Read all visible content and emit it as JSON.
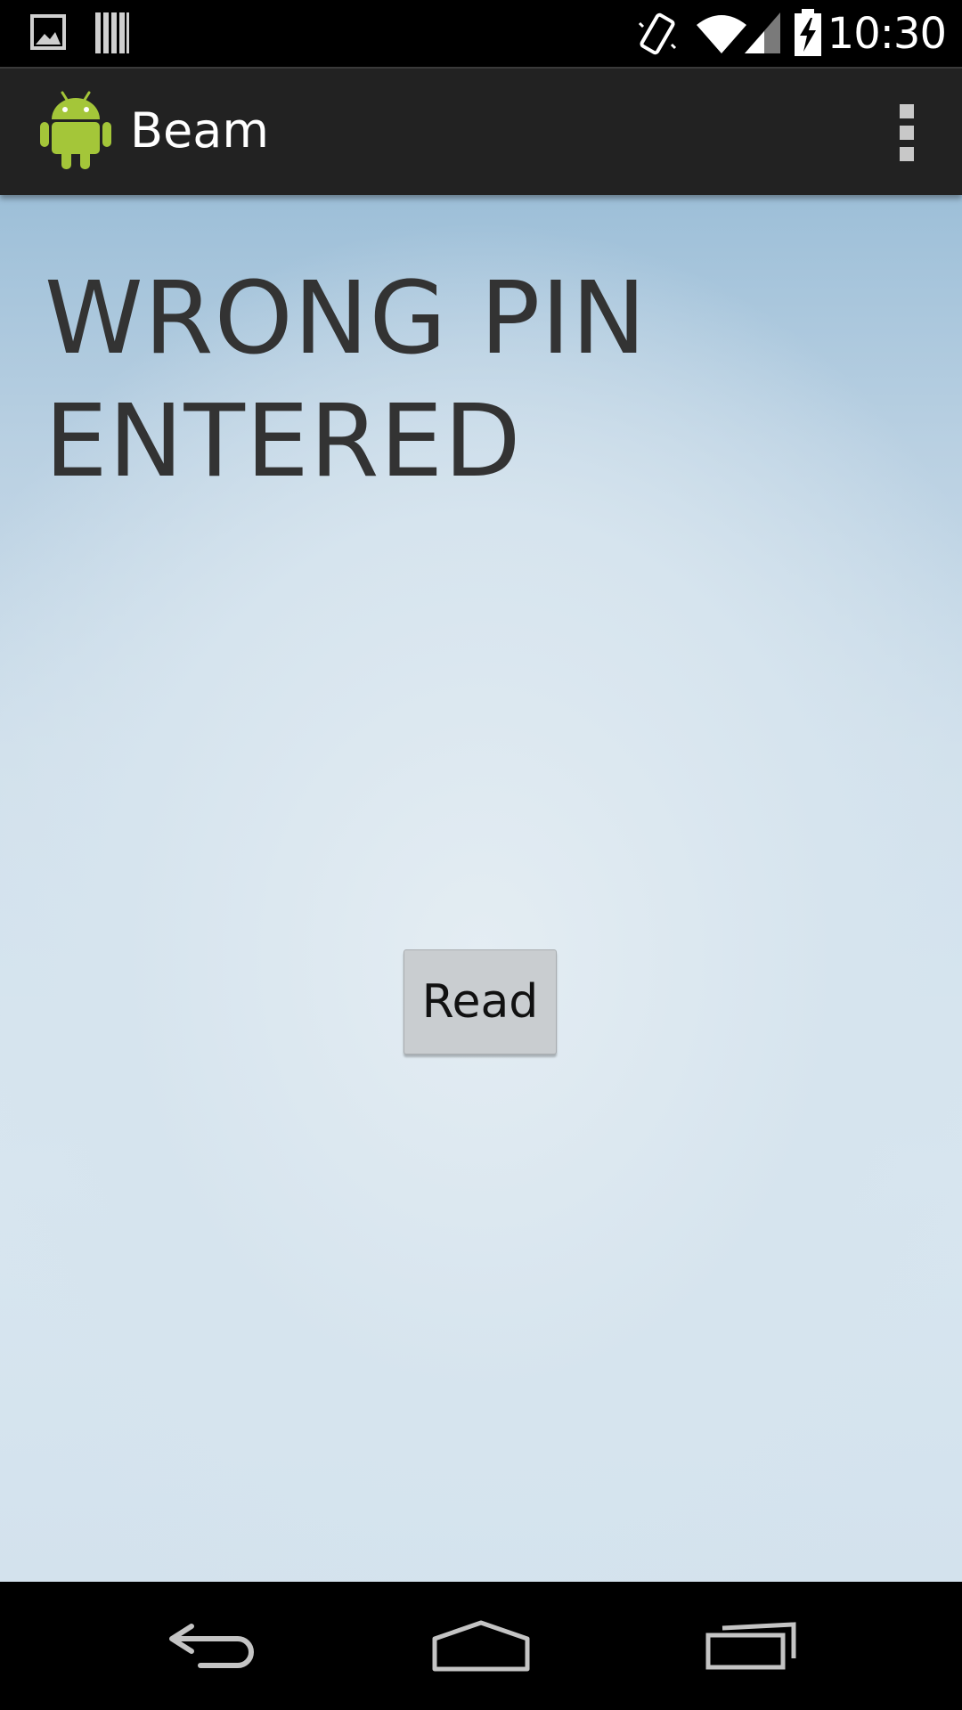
{
  "status_bar": {
    "time": "10:30",
    "icons": [
      "gallery-notification-icon",
      "barcode-notification-icon",
      "vibrate-icon",
      "wifi-icon",
      "cell-signal-icon",
      "battery-charging-icon"
    ]
  },
  "action_bar": {
    "title": "Beam",
    "logo": "android-robot-icon",
    "overflow": "overflow-menu-icon"
  },
  "content": {
    "message": "WRONG PIN ENTERED",
    "read_button_label": "Read"
  },
  "nav_bar": {
    "buttons": [
      "back-icon",
      "home-icon",
      "recents-icon"
    ]
  },
  "colors": {
    "status_bar_bg": "#000000",
    "action_bar_bg": "#222222",
    "message_text": "#333333",
    "button_bg": "#c9cdd0",
    "android_green": "#a4c639"
  }
}
